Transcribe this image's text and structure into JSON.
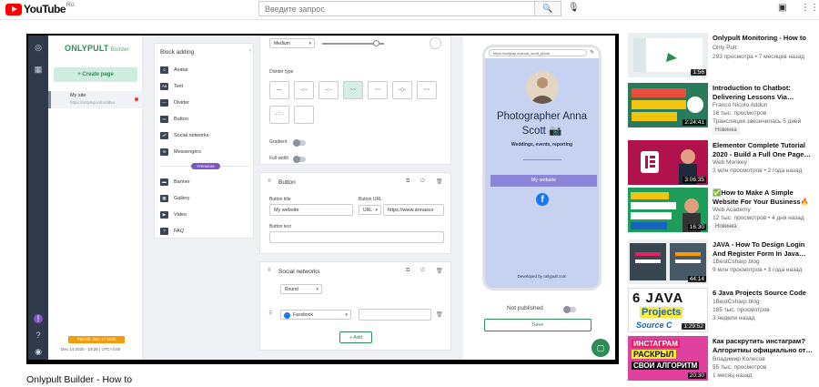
{
  "youtube": {
    "logo_text": "YouTube",
    "region": "RU",
    "search_placeholder": "Введите запрос"
  },
  "video": {
    "title": "Onlypult Builder - How to"
  },
  "app": {
    "brand": "ONLYPULT",
    "brand_sub": "Builder",
    "create_page": "+ Create page",
    "site_title": "My site",
    "site_url": "https://onlytap.io/ru/ddsu",
    "paid_label": "Paid till: Dec 17 2020",
    "paid_date": "Dec 14 2020 - 19:28  |  UTC+3:00",
    "block_adding": {
      "title": "Block adding",
      "items": [
        "Avatar",
        "Text",
        "Divider",
        "Button",
        "Social networks",
        "Messengers",
        "Banner",
        "Gallery",
        "Video",
        "FAQ"
      ],
      "premium": "PREMIUM"
    },
    "editor": {
      "size_select": "Medium",
      "divider_type": "Divider type",
      "gradient": "Gradient",
      "full_width": "Full width",
      "button_card_title": "Button",
      "button_title_label": "Button title",
      "button_title_value": "My website",
      "button_url_label": "Button URL",
      "url_scheme": "URL",
      "url_value": "https://www.annasco",
      "button_text_label": "Button text",
      "social_card_title": "Social networks",
      "social_style": "Round",
      "social_network": "Facebook",
      "add_label": "+ Add"
    },
    "preview": {
      "url": "https://onlytap.io/anna_scott_photo",
      "name": "Photographer Anna Scott 📷",
      "subtitle": "Weddings, events, reporting",
      "button": "My website",
      "developed": "Developed by onlypult.com",
      "not_published": "Not published",
      "save": "Save"
    }
  },
  "recommendations": [
    {
      "title": "Onlypult Monitoring - How to",
      "channel": "Only Pult",
      "meta": "293 просмотра • 7 месяцев назад",
      "duration": "1:56",
      "badge": ""
    },
    {
      "title": "Introduction to Chatbot: Delivering Lessons Via…",
      "channel": "Franco Nicolo Addun",
      "meta": "16 тыс. просмотров",
      "meta2": "Трансляция закончилась 5 дней",
      "duration": "2:24:41",
      "badge": "Новинка"
    },
    {
      "title": "Elementor Complete Tutorial 2020 - Build a Full One Page…",
      "channel": "Web Monkey",
      "meta": "2 млн просмотров • 2 года назад",
      "duration": "3:06:35",
      "badge": ""
    },
    {
      "title": "✅How to Make A Simple Website For Your Business🔥",
      "channel": "Web Academy",
      "meta": "12 тыс. просмотров • 4 дня назад",
      "duration": "16:30",
      "badge": "Новинка"
    },
    {
      "title": "JAVA - How To Design Login And Register Form In Java…",
      "channel": "1BestCsharp blog",
      "meta": "9 млн просмотров • 3 года назад",
      "duration": "44:14",
      "badge": ""
    },
    {
      "title": "6 Java Projects Source Code",
      "channel": "1BestCsharp blog",
      "meta": "185 тыс. просмотров",
      "meta2": "3 недели назад",
      "duration": "1:29:52",
      "badge": ""
    },
    {
      "title": "Как раскрутить инстаграм? Алгоритмы официально от…",
      "channel": "Владимир Колесов",
      "meta": "55 тыс. просмотров",
      "meta2": "1 месяц назад",
      "duration": "20:30",
      "badge": ""
    }
  ]
}
